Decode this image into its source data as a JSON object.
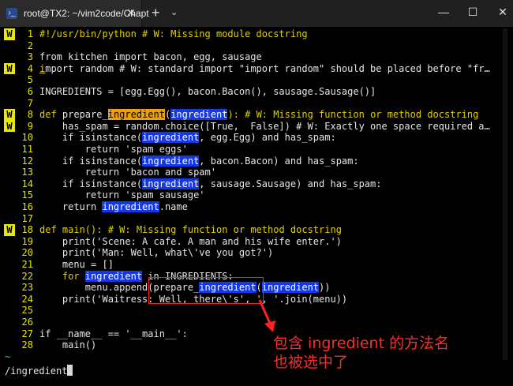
{
  "window": {
    "tab_icon": "powershell-icon",
    "tab_title": "root@TX2: ~/vim2code/Chapt",
    "tab_close": "✕",
    "new_tab": "+",
    "tab_menu": "⌄",
    "minimize": "—",
    "maximize": "☐",
    "close": "✕"
  },
  "editor": {
    "sign_marker": "W",
    "line_numbers": [
      "1",
      "2",
      "3",
      "4",
      "5",
      "6",
      "7",
      "8",
      "9",
      "10",
      "11",
      "12",
      "13",
      "14",
      "15",
      "16",
      "17",
      "18",
      "19",
      "20",
      "21",
      "22",
      "23",
      "24",
      "25",
      "26",
      "27",
      "28"
    ],
    "lines": {
      "l1": "#!/usr/bin/python # W: Missing module docstring",
      "l3": "from kitchen import bacon, egg, sausage",
      "l4a": "i",
      "l4b": "mport random # W: standard import \"import random\" should be placed before \"fr…",
      "l6": "INGREDIENTS = [egg.Egg(), bacon.Bacon(), sausage.Sausage()]",
      "l8_def": "def",
      "l8_name": " prepare_",
      "l8_hl": "ingredient",
      "l8_p1": "(",
      "l8_hl2": "ingredient",
      "l8_rest": "): # W: Missing function or method docstring",
      "l9": "    has_spam = random.choice([True,  False]) # W: Exactly one space required a…",
      "l10a": "    if isinstance(",
      "l10b": ", egg.Egg) and has_spam:",
      "l11": "        return 'spam eggs'",
      "l12a": "    if isinstance(",
      "l12b": ", bacon.Bacon) and has_spam:",
      "l13": "        return 'bacon and spam'",
      "l14a": "    if isinstance(",
      "l14b": ", sausage.Sausage) and has_spam:",
      "l15": "        return 'spam sausage'",
      "l16a": "    return ",
      "l16b": ".name",
      "l18_def": "def",
      "l18_rest": " main(): # W: Missing function or method docstring",
      "l19": "    print('Scene: A cafe. A man and his wife enter.')",
      "l20": "    print('Man: Well, what\\'ve you got?')",
      "l21": "    menu = []",
      "l22a": "    for ",
      "l22b": " in INGREDIENTS:",
      "l23a": "        menu.append(prepare_",
      "l23b": "(",
      "l23c": "))",
      "l24": "    print('Waitress: Well, there\\'s', ', '.join(menu))",
      "l27": "if __name__ == '__main__':",
      "l28": "    main()",
      "tilde": "~",
      "match_word": "ingredient"
    }
  },
  "command_line": "/ingredient",
  "annotation": {
    "line1": "包含 ingredient 的方法名",
    "line2": "也被选中了"
  },
  "colors": {
    "search_highlight": "#1437e8",
    "current_match": "#f0a000",
    "sign_column": "#e8e800",
    "keyword": "#e0d000",
    "annotation": "#ff2a2a"
  }
}
